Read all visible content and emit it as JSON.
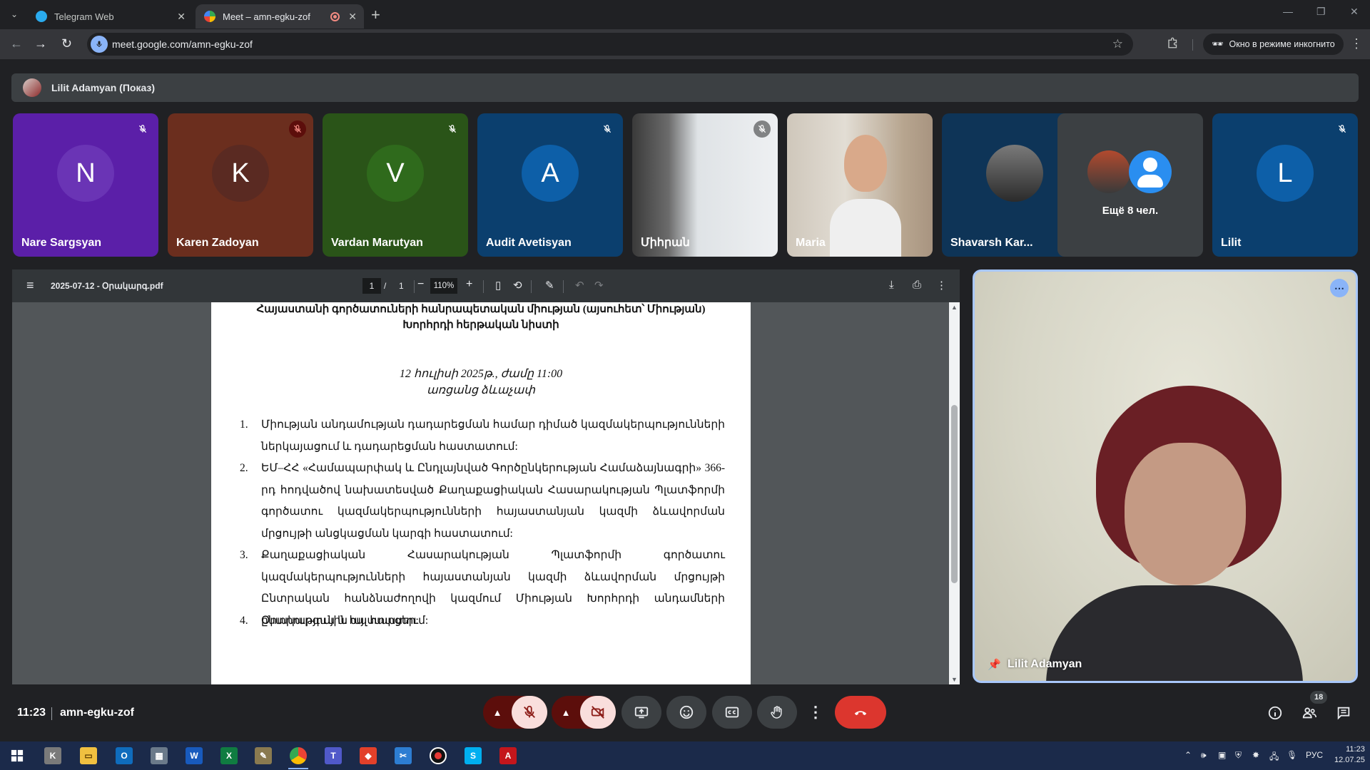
{
  "browser": {
    "tabs": [
      {
        "title": "Telegram Web",
        "favicon_color": "#2aabee"
      },
      {
        "title": "Meet – amn-egku-zof",
        "favicon_color": "#34a853",
        "active": true
      }
    ],
    "url": "meet.google.com/amn-egku-zof",
    "incognito_label": "Окно в режиме инкогнито"
  },
  "meet": {
    "presenter_label": "Lilit Adamyan (Показ)",
    "tiles": [
      {
        "initial": "N",
        "name": "Nare Sargsyan",
        "bg": "#5b1fa8",
        "circle": "#6a34b5"
      },
      {
        "initial": "K",
        "name": "Karen Zadoyan",
        "bg": "#6b2e1e",
        "circle": "#5a2a22"
      },
      {
        "initial": "V",
        "name": "Vardan Marutyan",
        "bg": "#2a5418",
        "circle": "#2f6a1c"
      },
      {
        "initial": "A",
        "name": "Audit Avetisyan",
        "bg": "#0b3f6e",
        "circle": "#0d5fa8"
      },
      {
        "initial": "",
        "name": "Միհրան",
        "bg": "#d9dde0"
      },
      {
        "initial": "",
        "name": "Maria",
        "bg": "#cfc7bb"
      },
      {
        "initial": "",
        "name": "Shavarsh Kar...",
        "bg": "#0e3457"
      },
      {
        "initial": "",
        "name": "",
        "more_label": "Ещё 8 чел.",
        "bg": "#3c4043"
      },
      {
        "initial": "L",
        "name": "Lilit",
        "bg": "#0b3f6e",
        "circle": "#0d5fa8"
      }
    ],
    "pinned_name": "Lilit Adamyan",
    "time": "11:23",
    "meeting_code": "amn-egku-zof",
    "participants_count": "18"
  },
  "pdf": {
    "filename": "2025-07-12 - Օրակարգ.pdf",
    "page_current": "1",
    "page_sep": "/",
    "page_total": "1",
    "zoom": "110%",
    "heading_line1": "Հայաստանի գործատուների հանրապետական միության (այսուհետ՝ Միության)",
    "heading_line2": "Խորհրդի հերթական նիստի",
    "date_line": "12 հուլիսի 2025թ., ժամը 11:00",
    "location_line": "առցանց ձևաչափ",
    "items": [
      {
        "num": "1.",
        "text": "Միության անդամության դադարեցման համար դիմած կազմակերպությունների ներկայացում և դադարեցման հաստատում:"
      },
      {
        "num": "2.",
        "text": "ԵՄ–ՀՀ «Համապարփակ և Ընդլայնված Գործընկերության Համաձայնագրի» 366-րդ հոդվածով նախատեսված Քաղաքացիական Հասարակության Պլատֆորմի գործատու կազմակերպությունների հայաստանյան կազմի ձևավորման մրցույթի անցկացման կարգի հաստատում:"
      },
      {
        "num": "3.",
        "text": "Քաղաքացիական Հասարակության Պլատֆորմի գործատու կազմակերպությունների հայաստանյան կազմի ձևավորման մրցույթի Ընտրական հանձնաժողովի կազմում Միության Խորհրդի անդամների ընտրություն և հաստատում:"
      },
      {
        "num": "4.",
        "text": "Օրակարգային այլ հարցեր:"
      }
    ]
  },
  "taskbar": {
    "clock_time": "11:23",
    "clock_date": "12.07.25",
    "lang": "РУС"
  }
}
